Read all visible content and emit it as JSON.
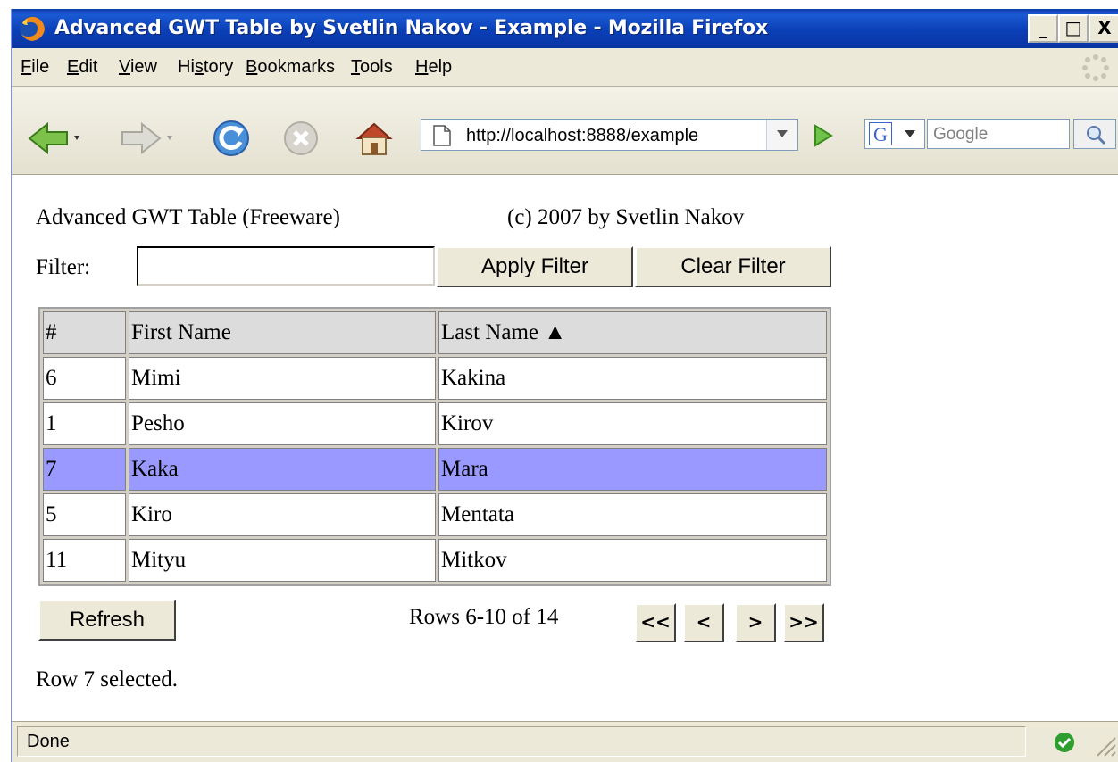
{
  "window": {
    "title": "Advanced GWT Table by Svetlin Nakov - Example - Mozilla Firefox",
    "controls": {
      "minimize": "_",
      "maximize": "□",
      "close": "X"
    }
  },
  "menu": {
    "items": [
      {
        "pre": "",
        "ul": "F",
        "post": "ile"
      },
      {
        "pre": "",
        "ul": "E",
        "post": "dit"
      },
      {
        "pre": "",
        "ul": "V",
        "post": "iew"
      },
      {
        "pre": "Hi",
        "ul": "s",
        "post": "tory"
      },
      {
        "pre": "",
        "ul": "B",
        "post": "ookmarks"
      },
      {
        "pre": "",
        "ul": "T",
        "post": "ools"
      },
      {
        "pre": "",
        "ul": "H",
        "post": "elp"
      }
    ]
  },
  "toolbar": {
    "url": "http://localhost:8888/example",
    "search_placeholder": "Google",
    "icons": [
      "back-icon",
      "forward-icon",
      "reload-icon",
      "stop-icon",
      "home-icon",
      "page-icon",
      "go-icon",
      "google-icon",
      "search-icon"
    ]
  },
  "content": {
    "title": "Advanced GWT Table (Freeware)",
    "copyright": "(c) 2007 by Svetlin Nakov",
    "filter_label": "Filter:",
    "filter_value": "",
    "apply_filter": "Apply Filter",
    "clear_filter": "Clear Filter"
  },
  "table": {
    "headers": [
      "#",
      "First Name",
      "Last Name ▲"
    ],
    "rows": [
      [
        "6",
        "Mimi",
        "Kakina"
      ],
      [
        "1",
        "Pesho",
        "Kirov"
      ],
      [
        "7",
        "Kaka",
        "Mara"
      ],
      [
        "5",
        "Kiro",
        "Mentata"
      ],
      [
        "11",
        "Mityu",
        "Mitkov"
      ]
    ],
    "selected_row_index": 2,
    "selected_color": "#9999ff"
  },
  "pager": {
    "refresh": "Refresh",
    "rows_info": "Rows 6-10 of 14",
    "first": "<<",
    "prev": "<",
    "next": ">",
    "last": ">>"
  },
  "selection_status": "Row 7 selected.",
  "statusbar": {
    "text": "Done"
  }
}
